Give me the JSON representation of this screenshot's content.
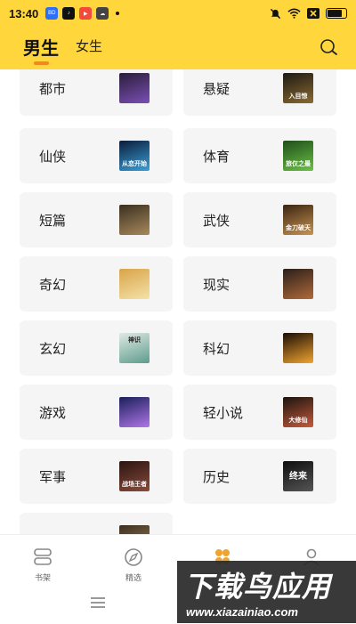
{
  "status_bar": {
    "time": "13:40",
    "app_icons": [
      {
        "name": "app-icon-blue",
        "text": "BD",
        "color": "#2f6ff7"
      },
      {
        "name": "tiktok-icon",
        "text": "♪",
        "color": "#111111"
      },
      {
        "name": "app-icon-red",
        "text": "▶",
        "color": "#f34a3b"
      },
      {
        "name": "app-icon-cloud",
        "text": "☁",
        "color": "#333333"
      }
    ],
    "battery_level": 0.8
  },
  "header": {
    "tabs": [
      {
        "label": "男生",
        "active": true
      },
      {
        "label": "女生",
        "active": false
      }
    ],
    "search_icon": "search-icon",
    "accent": "#ffd63b",
    "indicator_color": "#f08a1c"
  },
  "categories": [
    {
      "label": "都市",
      "cover_text": "",
      "cover": [
        "#2b1d3a",
        "#7a4fb5"
      ]
    },
    {
      "label": "悬疑",
      "cover_text": "入目惊",
      "cover": [
        "#1d1a14",
        "#8a6a32"
      ]
    },
    {
      "label": "仙侠",
      "cover_text": "从恋开始",
      "cover": [
        "#0c1d3a",
        "#3aa0d8"
      ]
    },
    {
      "label": "体育",
      "cover_text": "旅仅之最",
      "cover": [
        "#1f4d1c",
        "#6cc244"
      ]
    },
    {
      "label": "短篇",
      "cover_text": "",
      "cover": [
        "#3b2f20",
        "#a88a5c"
      ]
    },
    {
      "label": "武侠",
      "cover_text": "金刀破天",
      "cover": [
        "#3a2412",
        "#c89452"
      ]
    },
    {
      "label": "奇幻",
      "cover_text": "",
      "cover": [
        "#d8a44a",
        "#f4e2a8"
      ]
    },
    {
      "label": "现实",
      "cover_text": "",
      "cover": [
        "#2a1f1a",
        "#b06a3a"
      ]
    },
    {
      "label": "玄幻",
      "cover_text": "神识",
      "cover": [
        "#dfe9e3",
        "#5d9c8c"
      ]
    },
    {
      "label": "科幻",
      "cover_text": "",
      "cover": [
        "#1a0d05",
        "#f0a430"
      ]
    },
    {
      "label": "游戏",
      "cover_text": "",
      "cover": [
        "#1a1f5a",
        "#b076e8"
      ]
    },
    {
      "label": "轻小说",
      "cover_text": "大修仙",
      "cover": [
        "#1b1410",
        "#c45a3a"
      ]
    },
    {
      "label": "军事",
      "cover_text": "战场王者",
      "cover": [
        "#2a1512",
        "#8a4a3a"
      ]
    },
    {
      "label": "历史",
      "cover_text": "终来",
      "cover": [
        "#0f0f0f",
        "#555555"
      ]
    },
    {
      "label": "",
      "cover_text": "",
      "cover": [
        "#3a2d20",
        "#a88a5c"
      ]
    }
  ],
  "bottom_nav": [
    {
      "label": "书架",
      "icon": "bookshelf-icon"
    },
    {
      "label": "精选",
      "icon": "compass-icon"
    },
    {
      "label": "",
      "icon": "category-icon"
    },
    {
      "label": "",
      "icon": "profile-icon"
    }
  ],
  "watermark": {
    "title": "下载鸟应用",
    "url": "www.xiazainiao.com"
  }
}
